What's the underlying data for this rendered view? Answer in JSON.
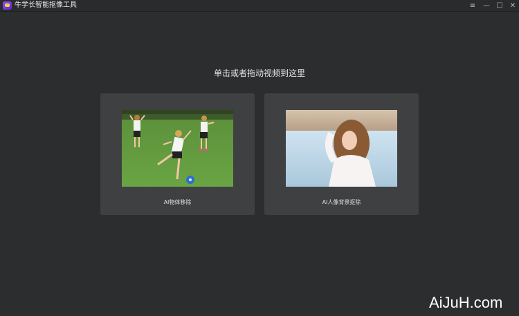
{
  "app": {
    "title": "牛学长智能抠像工具",
    "controls": {
      "menu": "≡",
      "minimize": "—",
      "maximize": "☐",
      "close": "✕"
    }
  },
  "main": {
    "prompt": "单击或者拖动视频到这里",
    "cards": [
      {
        "label": "AI物体移除",
        "image": "soccer-kids-photo"
      },
      {
        "label": "AI人像背景抠除",
        "image": "woman-portrait-photo"
      }
    ]
  },
  "watermark": "AiJuH.com"
}
